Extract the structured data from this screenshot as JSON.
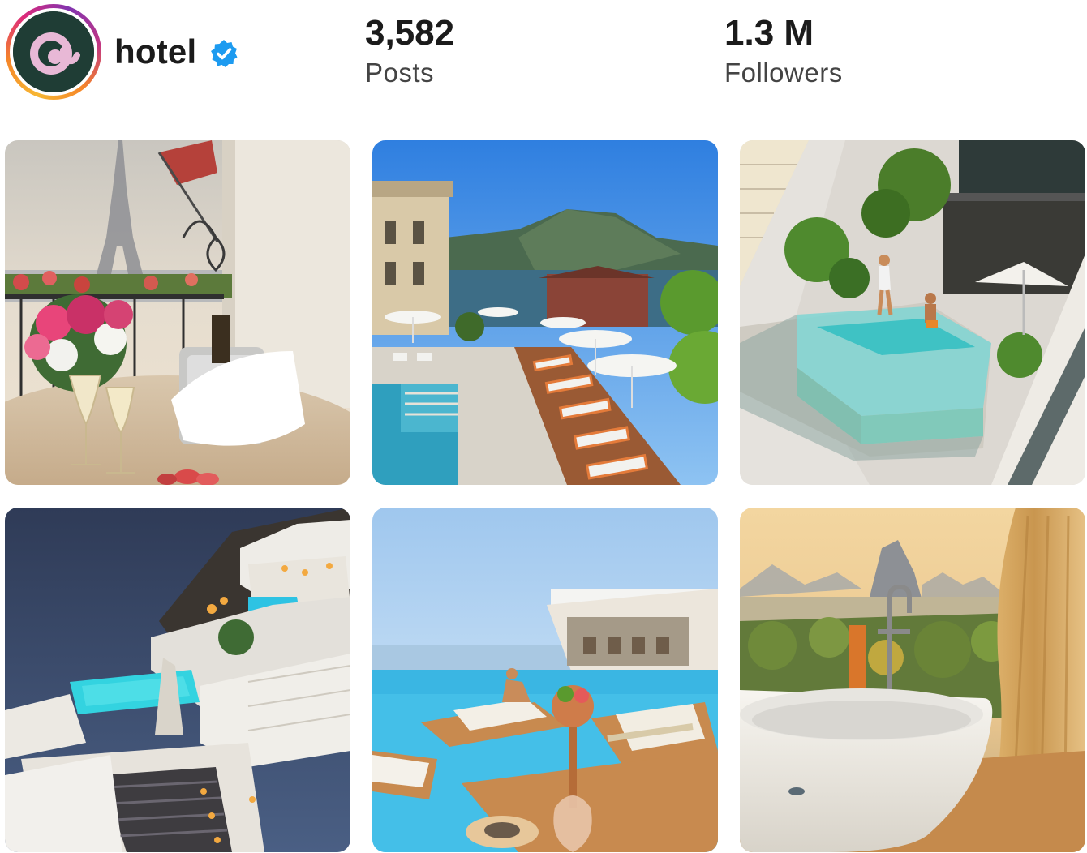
{
  "profile": {
    "handle": "hotel",
    "avatar_letter": "a",
    "verified_icon": "verified-badge-icon",
    "ring_colors": [
      "#f7b733",
      "#f58529",
      "#dd2a7b",
      "#8134af"
    ],
    "avatar_bg": "#1f3d35",
    "verified_color": "#1d9bf0"
  },
  "stats": {
    "posts": {
      "value": "3,582",
      "label": "Posts"
    },
    "followers": {
      "value": "1.3 M",
      "label": "Followers"
    }
  },
  "grid": {
    "posts": [
      {
        "subject": "paris-balcony-eiffel-champagne"
      },
      {
        "subject": "lake-pool-deck-sun-loungers"
      },
      {
        "subject": "glass-rooftop-pool-terrace"
      },
      {
        "subject": "santorini-dusk-pool-stairs"
      },
      {
        "subject": "infinity-pool-floating-daybeds"
      },
      {
        "subject": "freestanding-bathtub-mountain-view"
      }
    ]
  }
}
